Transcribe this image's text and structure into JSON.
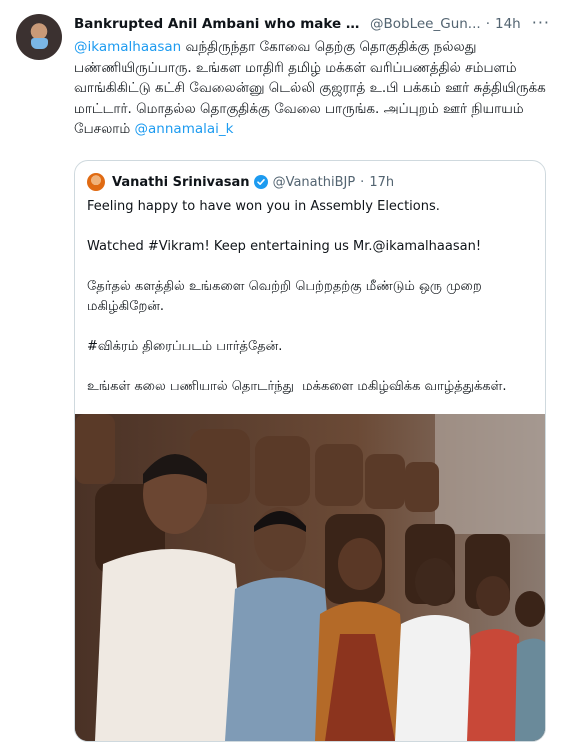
{
  "tweet": {
    "author_name": "Bankrupted Anil Ambani who make Rafale J...",
    "handle": "@BobLee_Gun...",
    "separator": "·",
    "time": "14h",
    "more_icon": "more-horizontal-icon",
    "text_lead_mention": "@ikamalhaasan",
    "text_body": " வந்திருந்தா கோவை தெற்கு தொகுதிக்கு நல்லது பண்ணியிருப்பாரு. உங்கள மாதிரி தமிழ் மக்கள் வரிப்பணத்தில் சம்பளம் வாங்கிகிட்டு கட்சி வேலைன்னு டெல்லி குஜராத் உ.பி பக்கம் ஊர் சுத்தியிருக்க மாட்டார். மொதல்ல தொகுதிக்கு வேலை பாருங்க. அப்புறம் ஊர் நியாயம் பேசலாம் ",
    "text_tail_mention": "@annamalai_k"
  },
  "quote": {
    "author_name": "Vanathi Srinivasan",
    "verified_icon": "verified-badge-icon",
    "handle": "@VanathiBJP",
    "separator": "·",
    "time": "17h",
    "text": "Feeling happy to have won you in Assembly Elections.\n\nWatched #Vikram! Keep entertaining us Mr.@ikamalhaasan!\n\nதேர்தல் களத்தில் உங்களை வெற்றி பெற்றதற்கு மீண்டும் ஒரு முறை மகிழ்கிறேன்.\n\n#விக்ரம் திரைப்படம் பார்த்தேன்.\n\nஉங்கள் கலை பணியால் தொடர்ந்து  மக்களை மகிழ்விக்க வாழ்த்துக்கள்."
  },
  "colors": {
    "link": "#1d9bf0",
    "text": "#0f1419",
    "secondary": "#536471",
    "border": "#cfd9de"
  }
}
